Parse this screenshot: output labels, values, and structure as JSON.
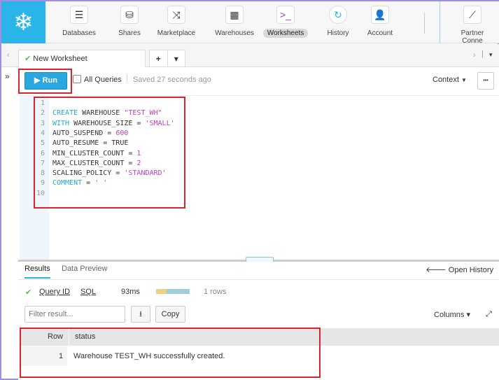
{
  "nav": {
    "items": [
      {
        "label": "Databases",
        "icon": "database-icon",
        "glyph": "☰"
      },
      {
        "label": "Shares",
        "icon": "shares-icon",
        "glyph": "⛁"
      },
      {
        "label": "Marketplace",
        "icon": "shuffle-icon",
        "glyph": "⤨"
      },
      {
        "label": "Warehouses",
        "icon": "warehouse-grid-icon",
        "glyph": "▦"
      },
      {
        "label": "Worksheets",
        "icon": "terminal-icon",
        "glyph": ">_",
        "active": true
      },
      {
        "label": "History",
        "icon": "history-icon",
        "glyph": "↻"
      },
      {
        "label": "Account",
        "icon": "user-icon",
        "glyph": "👤"
      },
      {
        "label": "Partner Conne",
        "icon": "partner-connect-icon",
        "glyph": "⟋"
      }
    ]
  },
  "tabs": {
    "worksheet": "New Worksheet",
    "add": "+",
    "menu": "▾",
    "prev": "‹",
    "next": "›"
  },
  "toolbar": {
    "run": "Run",
    "all_queries": "All Queries",
    "saved": "Saved 27 seconds ago",
    "context": "Context",
    "more": "•••",
    "expand": "»"
  },
  "editor": {
    "lines": [
      [],
      [
        [
          "CREATE",
          "kw"
        ],
        [
          " WAREHOUSE ",
          "pl"
        ],
        [
          "\"TEST_WH\"",
          "str"
        ]
      ],
      [
        [
          "WITH",
          "kw"
        ],
        [
          " WAREHOUSE_SIZE = ",
          "pl"
        ],
        [
          "'SMALL'",
          "str"
        ]
      ],
      [
        [
          "AUTO_SUSPEND = ",
          "pl"
        ],
        [
          "600",
          "num"
        ]
      ],
      [
        [
          "AUTO_RESUME = TRUE",
          "pl"
        ]
      ],
      [
        [
          "MIN_CLUSTER_COUNT = ",
          "pl"
        ],
        [
          "1",
          "num"
        ]
      ],
      [
        [
          "MAX_CLUSTER_COUNT = ",
          "pl"
        ],
        [
          "2",
          "num"
        ]
      ],
      [
        [
          "SCALING_POLICY = ",
          "pl"
        ],
        [
          "'STANDARD'",
          "str"
        ]
      ],
      [
        [
          "COMMENT",
          "kw"
        ],
        [
          " = ",
          "pl"
        ],
        [
          "' '",
          "str"
        ]
      ],
      []
    ]
  },
  "results": {
    "tabs": [
      "Results",
      "Data Preview"
    ],
    "open_history": "Open History",
    "query_id": "Query ID",
    "sql": "SQL",
    "duration": "93ms",
    "rows": "1 rows",
    "filter_placeholder": "Filter result...",
    "copy": "Copy",
    "columns": "Columns ▾",
    "columns_header": [
      "Row",
      "status"
    ],
    "table": [
      [
        "1",
        "Warehouse TEST_WH successfully created."
      ]
    ]
  },
  "colors": {
    "brand": "#29B5E8",
    "highlight": "#D9232D",
    "success": "#5cb85c"
  }
}
